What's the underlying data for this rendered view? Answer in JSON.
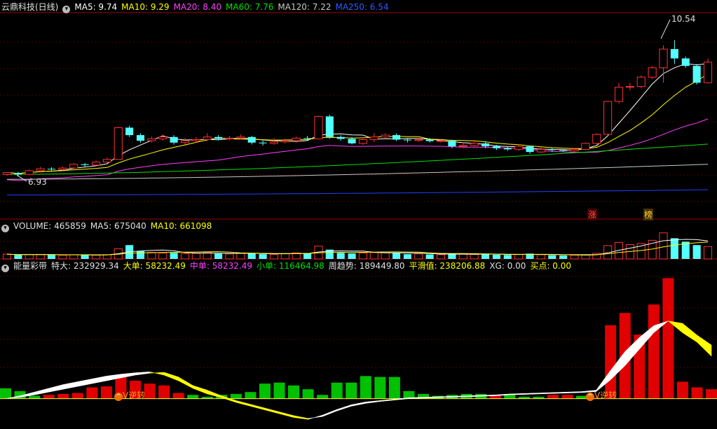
{
  "main_legend": {
    "stock_name": "云鼎科技(日线)",
    "ma5": "MA5: 9.74",
    "ma10": "MA10: 9.29",
    "ma20": "MA20: 8.40",
    "ma60": "MA60: 7.76",
    "ma120": "MA120: 7.22",
    "ma250": "MA250: 6.54"
  },
  "volume_legend": {
    "volume": "VOLUME: 465859",
    "ma5": "MA5: 675040",
    "ma10": "MA10: 661098"
  },
  "indicator_legend": {
    "name": "能量彩带",
    "tedae": "特大: 232929.34",
    "dadan": "大单: 58232.49",
    "zhongdan": "中单: 58232.49",
    "xiaodan": "小单: 116464.98",
    "zhouqushi": "周趋势: 189449.80",
    "pinghua": "平滑值: 238206.88",
    "xg": "XG: 0.00",
    "maidian": "买点: 0.00"
  },
  "annotations": {
    "high_price": "10.54",
    "low_price": "6.93",
    "zhang_marker": "涨",
    "bang_marker": "榜",
    "signal_1": "V逆转",
    "signal_2": "V逆转"
  },
  "colors": {
    "up": "#ff3232",
    "down": "#54ffff",
    "ma5": "#ffffff",
    "ma10": "#ffff00",
    "ma20": "#ff40ff",
    "ma60": "#00e000",
    "ma120": "#c8c8c8",
    "ma250": "#2040ff",
    "bar_red": "#e00000",
    "bar_green": "#00c000",
    "ribbon_white": "#ffffff",
    "ribbon_yellow": "#ffff00"
  },
  "chart_data": [
    {
      "type": "candlestick",
      "ylim": [
        6.0,
        11.2
      ],
      "high_label": 10.54,
      "low_label": 6.93,
      "candles": [
        [
          6.95,
          7.0,
          6.92,
          6.98
        ],
        [
          6.98,
          6.95,
          6.9,
          7.02
        ],
        [
          6.95,
          7.05,
          6.93,
          7.08
        ],
        [
          7.05,
          7.1,
          7.0,
          7.15
        ],
        [
          7.1,
          7.08,
          7.04,
          7.14
        ],
        [
          7.08,
          7.12,
          7.05,
          7.16
        ],
        [
          7.12,
          7.22,
          7.1,
          7.25
        ],
        [
          7.22,
          7.2,
          7.16,
          7.26
        ],
        [
          7.2,
          7.28,
          7.18,
          7.32
        ],
        [
          7.28,
          7.35,
          7.25,
          7.4
        ],
        [
          7.35,
          8.2,
          7.35,
          8.22
        ],
        [
          8.2,
          8.0,
          7.95,
          8.25
        ],
        [
          8.0,
          7.85,
          7.8,
          8.05
        ],
        [
          7.85,
          7.9,
          7.8,
          7.96
        ],
        [
          7.9,
          7.95,
          7.85,
          8.02
        ],
        [
          7.95,
          7.8,
          7.75,
          8.0
        ],
        [
          7.8,
          7.85,
          7.75,
          7.92
        ],
        [
          7.85,
          7.88,
          7.8,
          7.95
        ],
        [
          7.88,
          7.95,
          7.84,
          8.05
        ],
        [
          7.95,
          7.9,
          7.86,
          8.0
        ],
        [
          7.9,
          7.92,
          7.86,
          7.98
        ],
        [
          7.92,
          7.95,
          7.88,
          8.02
        ],
        [
          7.95,
          7.8,
          7.75,
          7.98
        ],
        [
          7.8,
          7.78,
          7.72,
          7.85
        ],
        [
          7.78,
          7.82,
          7.74,
          7.92
        ],
        [
          7.82,
          7.85,
          7.78,
          7.9
        ],
        [
          7.85,
          7.92,
          7.8,
          7.96
        ],
        [
          7.92,
          7.9,
          7.85,
          7.98
        ],
        [
          7.9,
          8.5,
          7.9,
          8.52
        ],
        [
          8.5,
          7.95,
          7.9,
          8.55
        ],
        [
          7.95,
          7.9,
          7.85,
          8.0
        ],
        [
          7.9,
          7.78,
          7.75,
          7.95
        ],
        [
          7.78,
          7.88,
          7.74,
          7.95
        ],
        [
          7.88,
          7.95,
          7.82,
          8.05
        ],
        [
          7.95,
          8.0,
          7.9,
          8.05
        ],
        [
          8.0,
          7.88,
          7.84,
          8.05
        ],
        [
          7.88,
          7.86,
          7.8,
          7.92
        ],
        [
          7.86,
          7.88,
          7.82,
          7.92
        ],
        [
          7.88,
          7.84,
          7.8,
          7.92
        ],
        [
          7.84,
          7.85,
          7.8,
          7.9
        ],
        [
          7.85,
          7.7,
          7.65,
          7.88
        ],
        [
          7.7,
          7.72,
          7.66,
          7.8
        ],
        [
          7.72,
          7.78,
          7.7,
          7.82
        ],
        [
          7.78,
          7.7,
          7.65,
          7.82
        ],
        [
          7.7,
          7.65,
          7.6,
          7.74
        ],
        [
          7.65,
          7.62,
          7.58,
          7.7
        ],
        [
          7.62,
          7.7,
          7.58,
          7.75
        ],
        [
          7.7,
          7.55,
          7.5,
          7.72
        ],
        [
          7.55,
          7.62,
          7.52,
          7.68
        ],
        [
          7.62,
          7.6,
          7.55,
          7.66
        ],
        [
          7.6,
          7.58,
          7.55,
          7.62
        ],
        [
          7.58,
          7.62,
          7.55,
          7.65
        ],
        [
          7.62,
          7.78,
          7.6,
          7.8
        ],
        [
          7.78,
          8.02,
          7.75,
          8.05
        ],
        [
          8.02,
          8.9,
          7.98,
          8.92
        ],
        [
          8.9,
          9.28,
          8.85,
          9.4
        ],
        [
          9.28,
          9.3,
          9.2,
          9.4
        ],
        [
          9.3,
          9.55,
          9.25,
          9.6
        ],
        [
          9.55,
          9.8,
          9.5,
          9.85
        ],
        [
          9.8,
          10.3,
          9.4,
          10.4
        ],
        [
          10.3,
          10.05,
          9.9,
          10.54
        ],
        [
          10.05,
          9.85,
          9.8,
          10.1
        ],
        [
          9.85,
          9.4,
          9.35,
          9.9
        ],
        [
          9.4,
          9.95,
          9.38,
          10.05
        ]
      ]
    },
    {
      "type": "bar",
      "title": "VOLUME",
      "values": [
        180000,
        150000,
        160000,
        170000,
        150000,
        140000,
        160000,
        150000,
        140000,
        160000,
        380000,
        520000,
        300000,
        250000,
        220000,
        230000,
        200000,
        210000,
        240000,
        200000,
        190000,
        210000,
        220000,
        180000,
        170000,
        200000,
        230000,
        220000,
        480000,
        350000,
        230000,
        210000,
        220000,
        240000,
        260000,
        220000,
        180000,
        190000,
        170000,
        160000,
        210000,
        180000,
        170000,
        190000,
        160000,
        150000,
        170000,
        200000,
        160000,
        140000,
        130000,
        140000,
        160000,
        210000,
        500000,
        620000,
        540000,
        580000,
        700000,
        980000,
        780000,
        650000,
        520000,
        465859
      ],
      "ma5": 675040,
      "ma10": 661098,
      "ylim": [
        0,
        1000000
      ]
    },
    {
      "type": "bar",
      "title": "能量彩带",
      "bars": [
        2.2,
        1.6,
        0.6,
        0.8,
        1.0,
        1.2,
        2.4,
        2.6,
        5.0,
        3.8,
        3.2,
        2.8,
        1.2,
        0.8,
        0.4,
        0.8,
        1.0,
        1.4,
        3.2,
        3.4,
        2.8,
        2.0,
        0.8,
        3.4,
        3.4,
        4.8,
        4.6,
        4.6,
        1.6,
        1.0,
        0.6,
        0.8,
        1.0,
        1.0,
        0.6,
        0.8,
        0.4,
        0.4,
        0.8,
        0.8,
        0.6,
        0.2,
        15.6,
        18.2,
        13.6,
        20.0,
        25.6,
        3.6,
        2.4,
        2.0
      ],
      "bar_colors": [
        "g",
        "g",
        "g",
        "r",
        "r",
        "r",
        "r",
        "r",
        "r",
        "r",
        "r",
        "r",
        "r",
        "g",
        "g",
        "g",
        "g",
        "g",
        "g",
        "g",
        "g",
        "g",
        "g",
        "g",
        "g",
        "g",
        "g",
        "g",
        "g",
        "g",
        "g",
        "g",
        "g",
        "g",
        "r",
        "g",
        "g",
        "g",
        "r",
        "r",
        "g",
        "r",
        "r",
        "r",
        "r",
        "r",
        "r",
        "r",
        "r",
        "r"
      ],
      "ribbon_a": [
        0.0,
        0.3,
        0.8,
        1.4,
        2.0,
        2.6,
        3.2,
        3.8,
        4.4,
        5.0,
        5.4,
        5.6,
        4.6,
        2.8,
        1.8,
        0.6,
        -0.4,
        -1.2,
        -2.0,
        -2.8,
        -3.6,
        -4.2,
        -3.8,
        -2.6,
        -1.6,
        -1.0,
        -0.6,
        -0.3,
        0.0,
        0.1,
        0.2,
        0.3,
        0.4,
        0.5,
        0.6,
        0.8,
        0.9,
        1.0,
        1.1,
        1.2,
        1.3,
        1.5,
        4.0,
        7.0,
        10.5,
        14.0,
        16.5,
        16.0,
        13.5,
        11.4
      ],
      "ribbon_b": [
        0.0,
        0.6,
        1.4,
        2.2,
        3.0,
        3.6,
        4.2,
        4.8,
        5.2,
        5.5,
        5.7,
        5.0,
        3.8,
        2.2,
        1.0,
        0.2,
        -0.8,
        -1.6,
        -2.4,
        -3.2,
        -4.0,
        -4.4,
        -3.5,
        -2.3,
        -1.3,
        -0.7,
        -0.4,
        -0.1,
        0.2,
        0.3,
        0.4,
        0.5,
        0.6,
        0.7,
        0.8,
        1.0,
        1.1,
        1.2,
        1.3,
        1.4,
        1.5,
        1.8,
        6.0,
        10.0,
        13.0,
        15.5,
        16.5,
        14.0,
        12.0,
        9.0
      ],
      "ylim": [
        -6.0,
        27.0
      ]
    }
  ]
}
